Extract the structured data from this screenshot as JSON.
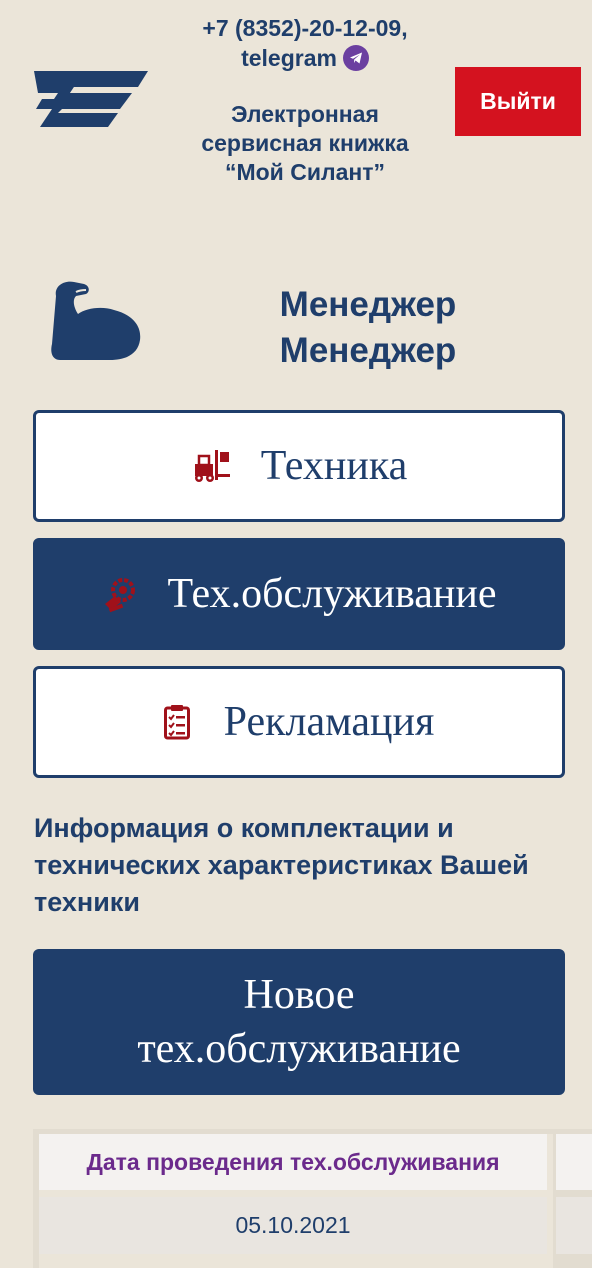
{
  "header": {
    "phone": "+7 (8352)-20-12-09,",
    "telegram_label": "telegram",
    "app_title_line1": "Электронная",
    "app_title_line2": "сервисная книжка",
    "app_title_line3": "“Мой Силант”",
    "logout_label": "Выйти"
  },
  "user": {
    "line1": "Менеджер",
    "line2": "Менеджер"
  },
  "nav": {
    "machines_label": "Техника",
    "maintenance_label": "Тех.обслуживание",
    "claims_label": "Рекламация"
  },
  "info": {
    "text": "Информация о комплектации и технических характеристиках Вашей техники"
  },
  "actions": {
    "new_maintenance_line1": "Новое",
    "new_maintenance_line2": "тех.обслуживание"
  },
  "table": {
    "columns": [
      "Дата проведения тех.обслуживания"
    ],
    "rows": [
      [
        "05.10.2021"
      ]
    ]
  },
  "colors": {
    "background": "#EBE5D9",
    "primary": "#1F3E6B",
    "danger": "#D4121F",
    "accent_red": "#A0111A",
    "header_text_purple": "#6B2A8C"
  },
  "icons": {
    "logo": "silant-logo-icon",
    "telegram": "telegram-icon",
    "user": "flexed-arm-icon",
    "machines": "forklift-icon",
    "maintenance": "gear-service-icon",
    "claims": "clipboard-checklist-icon"
  }
}
